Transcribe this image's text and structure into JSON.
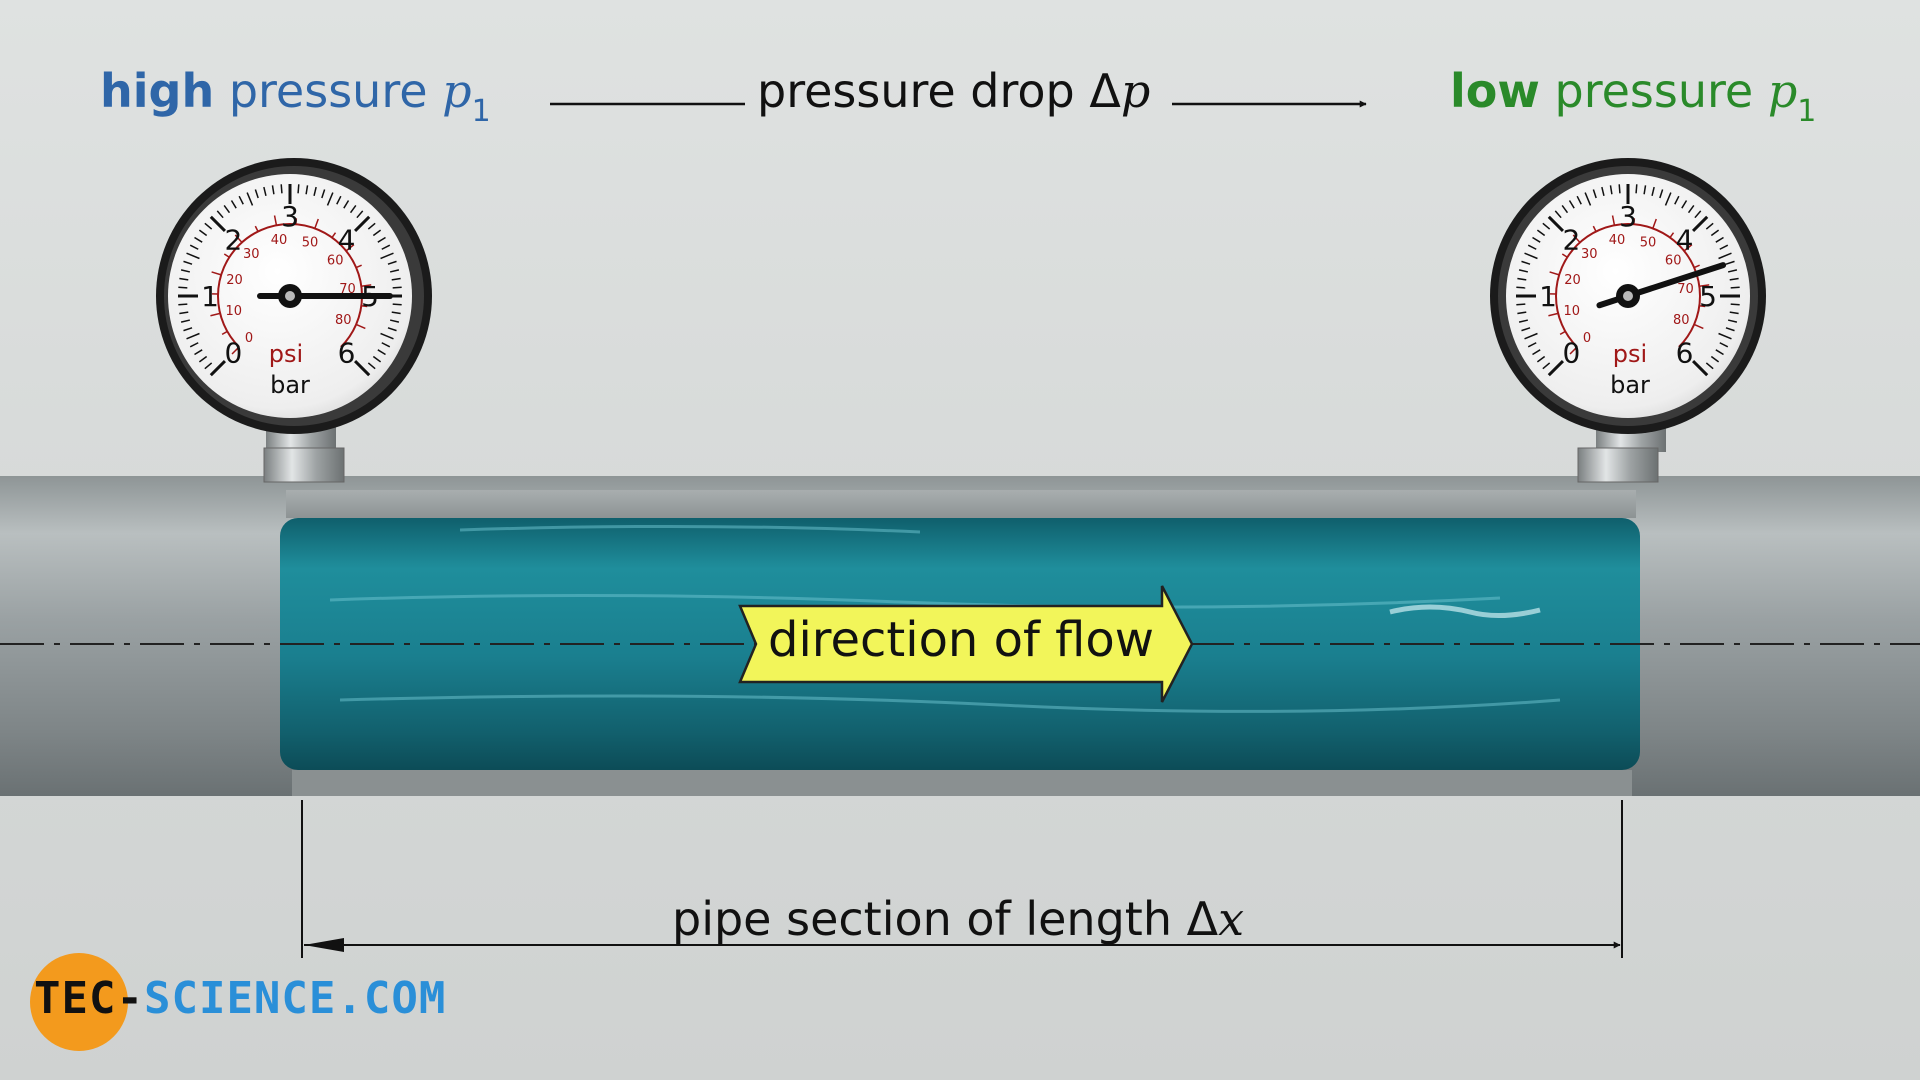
{
  "labels": {
    "high_bold": "high",
    "high_rest": " pressure ",
    "high_symbol": "p",
    "high_sub": "1",
    "drop_text": "pressure drop Δ",
    "drop_symbol": "p",
    "low_bold": "low",
    "low_rest": " pressure ",
    "low_symbol": "p",
    "low_sub": "1",
    "flow": "direction of flow",
    "length_text": "pipe section of length Δ",
    "length_symbol": "x"
  },
  "gauges": [
    {
      "bar_scale": [
        "0",
        "1",
        "2",
        "3",
        "4",
        "5",
        "6"
      ],
      "psi_scale": [
        "0",
        "10",
        "20",
        "30",
        "40",
        "50",
        "60",
        "70",
        "80"
      ],
      "psi_label": "psi",
      "bar_label": "bar",
      "reading_bar": 5.0
    },
    {
      "bar_scale": [
        "0",
        "1",
        "2",
        "3",
        "4",
        "5",
        "6"
      ],
      "psi_scale": [
        "0",
        "10",
        "20",
        "30",
        "40",
        "50",
        "60",
        "70",
        "80"
      ],
      "psi_label": "psi",
      "bar_label": "bar",
      "reading_bar": 4.6
    }
  ],
  "logo": {
    "part1": "TEC-",
    "part2": "SCIENCE",
    "part3": ".COM"
  },
  "colors": {
    "high_pressure": "#2f66a8",
    "low_pressure": "#2a8a2a",
    "water": "#1f8a9a",
    "arrow_fill": "#f2f55a",
    "logo_orange": "#f39a1d",
    "logo_blue": "#2a8fd8",
    "psi_red": "#a01818"
  }
}
